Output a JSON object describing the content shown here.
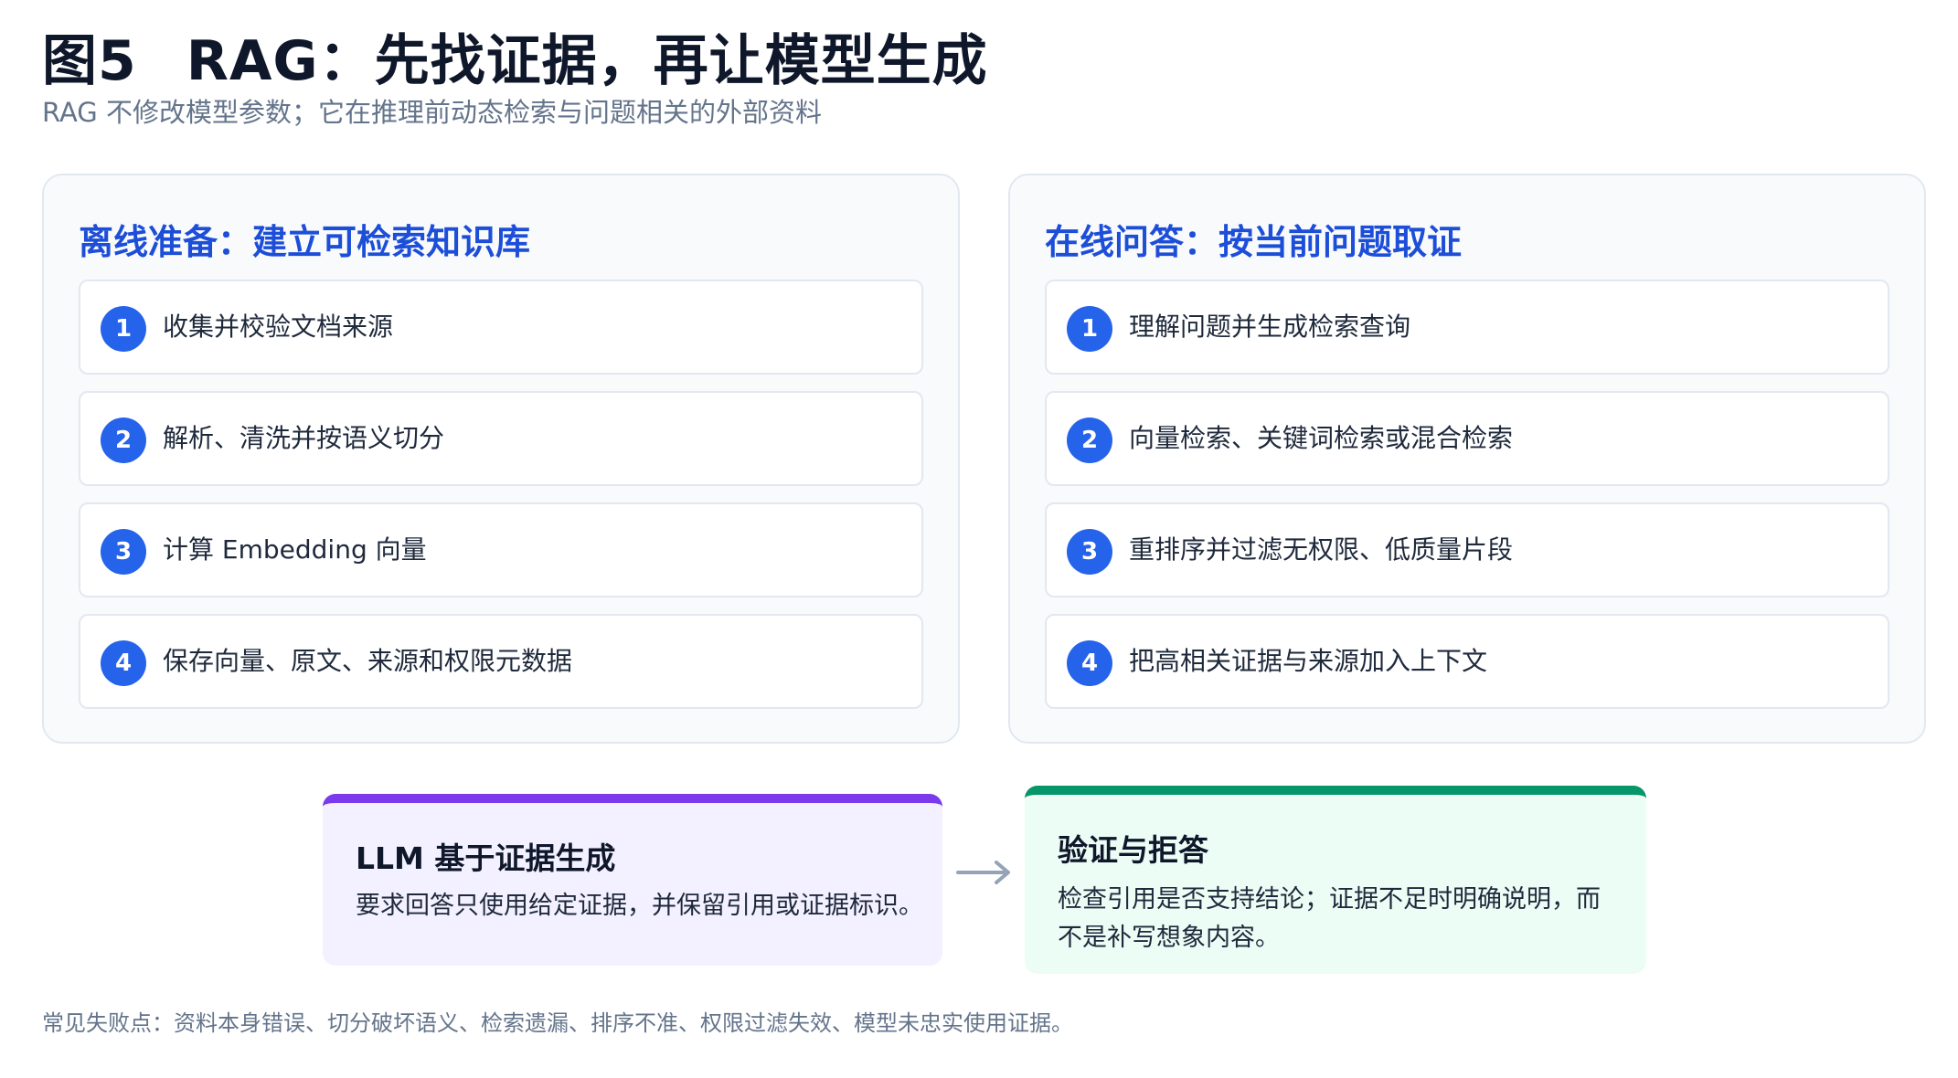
{
  "header": {
    "figure_label": "图5",
    "title": "RAG：先找证据，再让模型生成",
    "subtitle": "RAG 不修改模型参数；它在推理前动态检索与问题相关的外部资料"
  },
  "offline": {
    "title": "离线准备：建立可检索知识库",
    "steps": [
      {
        "num": "1",
        "text": "收集并校验文档来源"
      },
      {
        "num": "2",
        "text": "解析、清洗并按语义切分"
      },
      {
        "num": "3",
        "text": "计算 Embedding 向量"
      },
      {
        "num": "4",
        "text": "保存向量、原文、来源和权限元数据"
      }
    ]
  },
  "online": {
    "title": "在线问答：按当前问题取证",
    "steps": [
      {
        "num": "1",
        "text": "理解问题并生成检索查询"
      },
      {
        "num": "2",
        "text": "向量检索、关键词检索或混合检索"
      },
      {
        "num": "3",
        "text": "重排序并过滤无权限、低质量片段"
      },
      {
        "num": "4",
        "text": "把高相关证据与来源加入上下文"
      }
    ]
  },
  "generate": {
    "title": "LLM 基于证据生成",
    "body": "要求回答只使用给定证据，并保留引用或证据标识。"
  },
  "verify": {
    "title": "验证与拒答",
    "body": "检查引用是否支持结论；证据不足时明确说明，而不是补写想象内容。"
  },
  "footer": "常见失败点：资料本身错误、切分破坏语义、检索遗漏、排序不准、权限过滤失效、模型未忠实使用证据。",
  "colors": {
    "accent_blue": "#2563eb",
    "panel_title_blue": "#1d4ed8",
    "purple": "#7c3aed",
    "green": "#059669"
  }
}
